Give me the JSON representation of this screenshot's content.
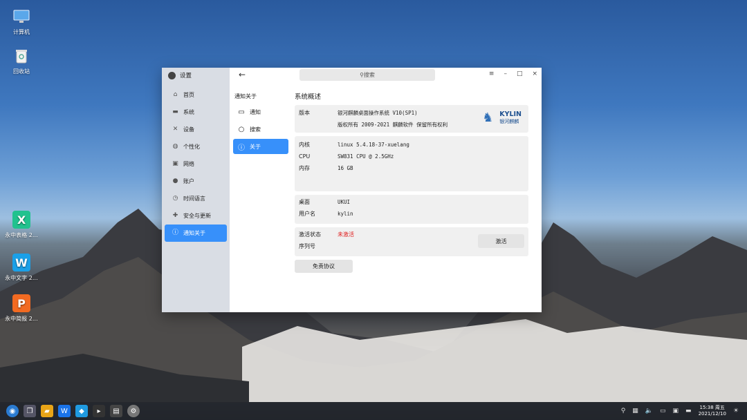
{
  "desktop": {
    "icons": [
      {
        "label": "计算机",
        "icon": "monitor-icon"
      },
      {
        "label": "回收站",
        "icon": "trash-icon"
      },
      {
        "label": "永中表格 2…",
        "icon": "spreadsheet-icon",
        "color": "#21c28e"
      },
      {
        "label": "永中文字 2…",
        "icon": "writer-icon",
        "color": "#1aa0e8"
      },
      {
        "label": "永中简报 2…",
        "icon": "presentation-icon",
        "color": "#f26a21"
      }
    ]
  },
  "window": {
    "app_title": "设置",
    "search_placeholder": "搜索",
    "controls": [
      "≡",
      "–",
      "□",
      "×"
    ],
    "sidebar": [
      {
        "label": "首页",
        "icon": "home-icon"
      },
      {
        "label": "系统",
        "icon": "system-icon"
      },
      {
        "label": "设备",
        "icon": "device-icon"
      },
      {
        "label": "个性化",
        "icon": "personalize-icon"
      },
      {
        "label": "网络",
        "icon": "network-icon"
      },
      {
        "label": "账户",
        "icon": "account-icon"
      },
      {
        "label": "时间语言",
        "icon": "clock-icon"
      },
      {
        "label": "安全与更新",
        "icon": "security-icon"
      },
      {
        "label": "通知关于",
        "icon": "info-icon",
        "active": true
      }
    ],
    "subnav": {
      "header": "通知关于",
      "items": [
        {
          "label": "通知",
          "icon": "notification-icon"
        },
        {
          "label": "搜索",
          "icon": "search-icon"
        },
        {
          "label": "关于",
          "icon": "info-icon",
          "active": true
        }
      ]
    },
    "content": {
      "title": "系统概述",
      "version_label": "版本",
      "version_value": "银河麒麟桌面操作系统 V10(SP1)",
      "copyright": "版权所有 2009-2021 麒麟软件 保留所有权利",
      "logo_text": "KYLIN",
      "logo_sub": "银河麒麟",
      "kernel_label": "内核",
      "kernel_value": "linux 5.4.18-37-xuelang",
      "cpu_label": "CPU",
      "cpu_value": "SW831 CPU @ 2.5GHz",
      "memory_label": "内存",
      "memory_value": "16 GB",
      "desktop_label": "桌面",
      "desktop_value": "UKUI",
      "user_label": "用户名",
      "user_value": "kylin",
      "activation_label": "激活状态",
      "activation_value": "未激活",
      "serial_label": "序列号",
      "activate_button": "激活",
      "disclaimer_button": "免责协议"
    }
  },
  "taskbar": {
    "time": "15:38 周五",
    "date": "2021/12/10"
  },
  "colors": {
    "accent": "#3790fa",
    "inactive_red": "#e02020"
  }
}
